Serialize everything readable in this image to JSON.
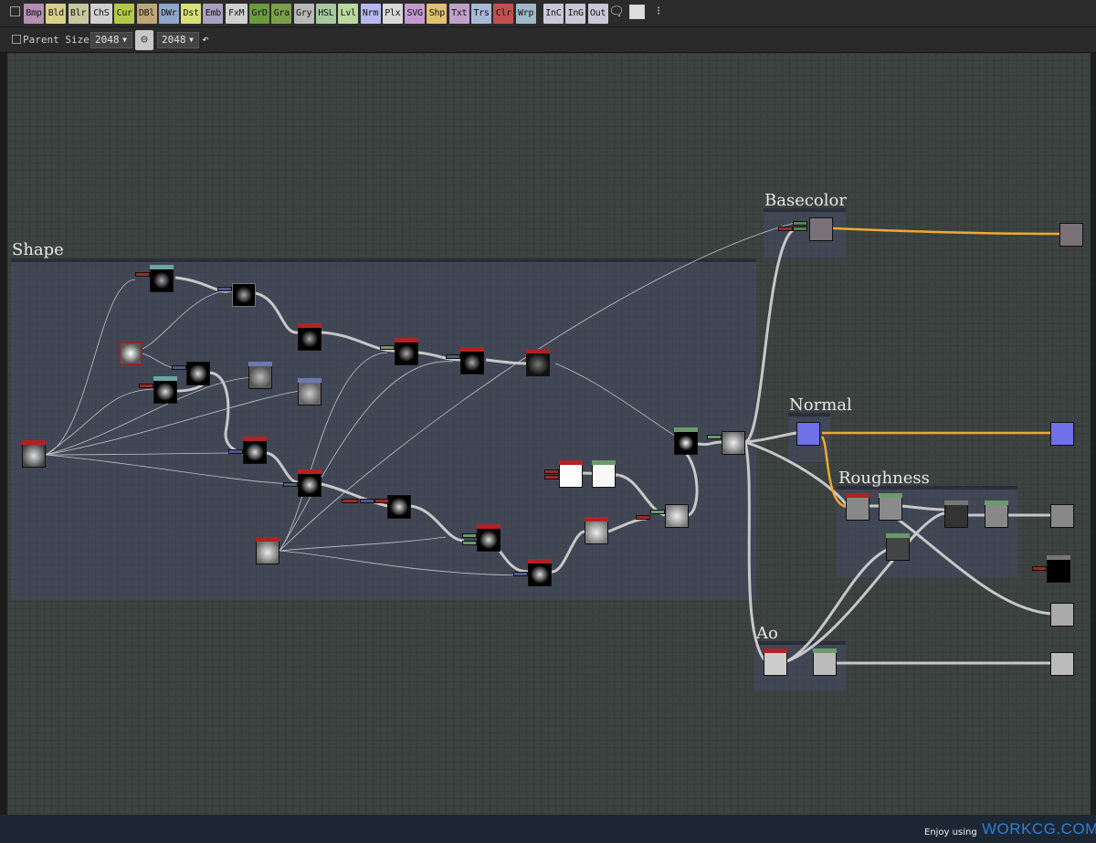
{
  "toolbar": {
    "node_buttons": [
      {
        "label": "Bmp",
        "color": "#b58eb1"
      },
      {
        "label": "Bld",
        "color": "#d8d08a"
      },
      {
        "label": "Blr",
        "color": "#c8c8a0"
      },
      {
        "label": "ChS",
        "color": "#d0d0d0"
      },
      {
        "label": "Cur",
        "color": "#b5c84a"
      },
      {
        "label": "DBl",
        "color": "#bfa67a"
      },
      {
        "label": "DWr",
        "color": "#8fa6c8"
      },
      {
        "label": "Dst",
        "color": "#d8e07a"
      },
      {
        "label": "Emb",
        "color": "#a8a0c0"
      },
      {
        "label": "FxM",
        "color": "#cfcfcf"
      },
      {
        "label": "GrD",
        "color": "#6a9a3a"
      },
      {
        "label": "Gra",
        "color": "#7aa04a"
      },
      {
        "label": "Gry",
        "color": "#b8b8b8"
      },
      {
        "label": "HSL",
        "color": "#a8c8a0"
      },
      {
        "label": "Lvl",
        "color": "#b8d8a0"
      },
      {
        "label": "Nrm",
        "color": "#b8b8f0"
      },
      {
        "label": "Plx",
        "color": "#d8d8d8"
      },
      {
        "label": "SVG",
        "color": "#c49ad0"
      },
      {
        "label": "Shp",
        "color": "#e0c070"
      },
      {
        "label": "Txt",
        "color": "#c0a0c8"
      },
      {
        "label": "Trs",
        "color": "#a8b8d8"
      },
      {
        "label": "Clr",
        "color": "#c05050"
      },
      {
        "label": "Wrp",
        "color": "#a0b8c8"
      },
      {
        "label": "InC",
        "color": "#c8c8d8"
      },
      {
        "label": "InG",
        "color": "#c8c8d8"
      },
      {
        "label": "Out",
        "color": "#c8c8d8"
      }
    ],
    "icons": [
      "comment-icon",
      "frame-icon",
      "pin-icon"
    ]
  },
  "params": {
    "parent_size_label": "Parent Size:",
    "width_value": "2048",
    "height_value": "2048",
    "link_icon": "chain-link-icon",
    "reset_icon": "undo-icon"
  },
  "frames": {
    "shape": "Shape",
    "basecolor": "Basecolor",
    "normal": "Normal",
    "roughness": "Roughness",
    "ao": "Ao"
  },
  "footer": {
    "enjoy_text": "Enjoy using",
    "brand": "WORKCG.COM"
  }
}
